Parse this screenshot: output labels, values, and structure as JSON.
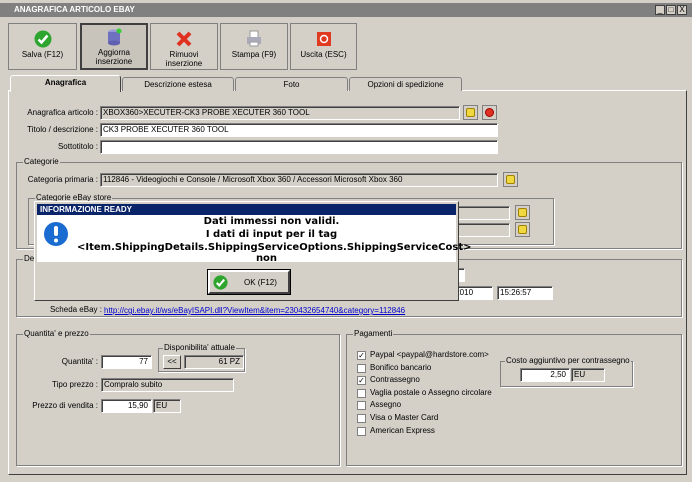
{
  "window": {
    "title": "ANAGRAFICA ARTICOLO EBAY",
    "controls": [
      "_",
      "□",
      "X"
    ]
  },
  "toolbar": [
    {
      "label": "Salva (F12)",
      "icon": "check-icon"
    },
    {
      "label": "Aggiorna inserzione",
      "icon": "database-icon"
    },
    {
      "label": "Rimuovi inserzione",
      "icon": "x-icon"
    },
    {
      "label": "Stampa (F9)",
      "icon": "printer-icon"
    },
    {
      "label": "Uscita (ESC)",
      "icon": "power-icon"
    }
  ],
  "tabs": [
    "Anagrafica",
    "Descrizione estesa",
    "Foto",
    "Opzioni di spedizione"
  ],
  "form": {
    "articolo_label": "Anagrafica articolo :",
    "articolo": "XBOX360>XECUTER-CK3 PROBE XECUTER 360 TOOL",
    "titolo_label": "Titolo / descrizione :",
    "titolo": "CK3 PROBE XECUTER 360 TOOL",
    "sottotitolo_label": "Sottotitolo :",
    "sottotitolo": ""
  },
  "categorie": {
    "title": "Categorie",
    "primaria_label": "Categoria primaria :",
    "primaria": "112846 - Videogiochi e Console / Microsoft Xbox 360 / Accessori Microsoft Xbox 360",
    "store_title": "Categorie eBay store"
  },
  "date": {
    "title": "De",
    "date_partial": "/2010",
    "time": "15:26:57",
    "scheda_label": "Scheda eBay :",
    "scheda_link": "http://cgi.ebay.it/ws/eBayISAPI.dll?ViewItem&item=230432654740&category=112846"
  },
  "quantita": {
    "title": "Quantita' e prezzo",
    "qty_label": "Quantita' :",
    "qty": "77",
    "disp_title": "Disponibilita' attuale",
    "disp_btn": "<<",
    "disp": "61 PZ",
    "tipo_label": "Tipo prezzo :",
    "tipo": "Compralo subito",
    "prezzo_label": "Prezzo di vendita :",
    "prezzo": "15,90",
    "currency": "EU"
  },
  "pagamenti": {
    "title": "Pagamenti",
    "items": [
      {
        "label": "Paypal <paypal@hardstore.com>",
        "checked": true
      },
      {
        "label": "Bonifico bancario",
        "checked": false
      },
      {
        "label": "Contrassegno",
        "checked": true
      },
      {
        "label": "Vaglia postale o Assegno circolare",
        "checked": false
      },
      {
        "label": "Assegno",
        "checked": false
      },
      {
        "label": "Visa o Master Card",
        "checked": false
      },
      {
        "label": "American Express",
        "checked": false
      }
    ],
    "costo_title": "Costo aggiuntivo per contrassegno",
    "costo": "2,50",
    "currency": "EU"
  },
  "dialog": {
    "title": "INFORMAZIONE READY",
    "lines": [
      "Dati immessi non validi.",
      "I dati di input per il tag",
      "<Item.ShippingDetails.ShippingServiceOptions.ShippingServiceCost> non"
    ],
    "ok": "OK (F12)"
  }
}
